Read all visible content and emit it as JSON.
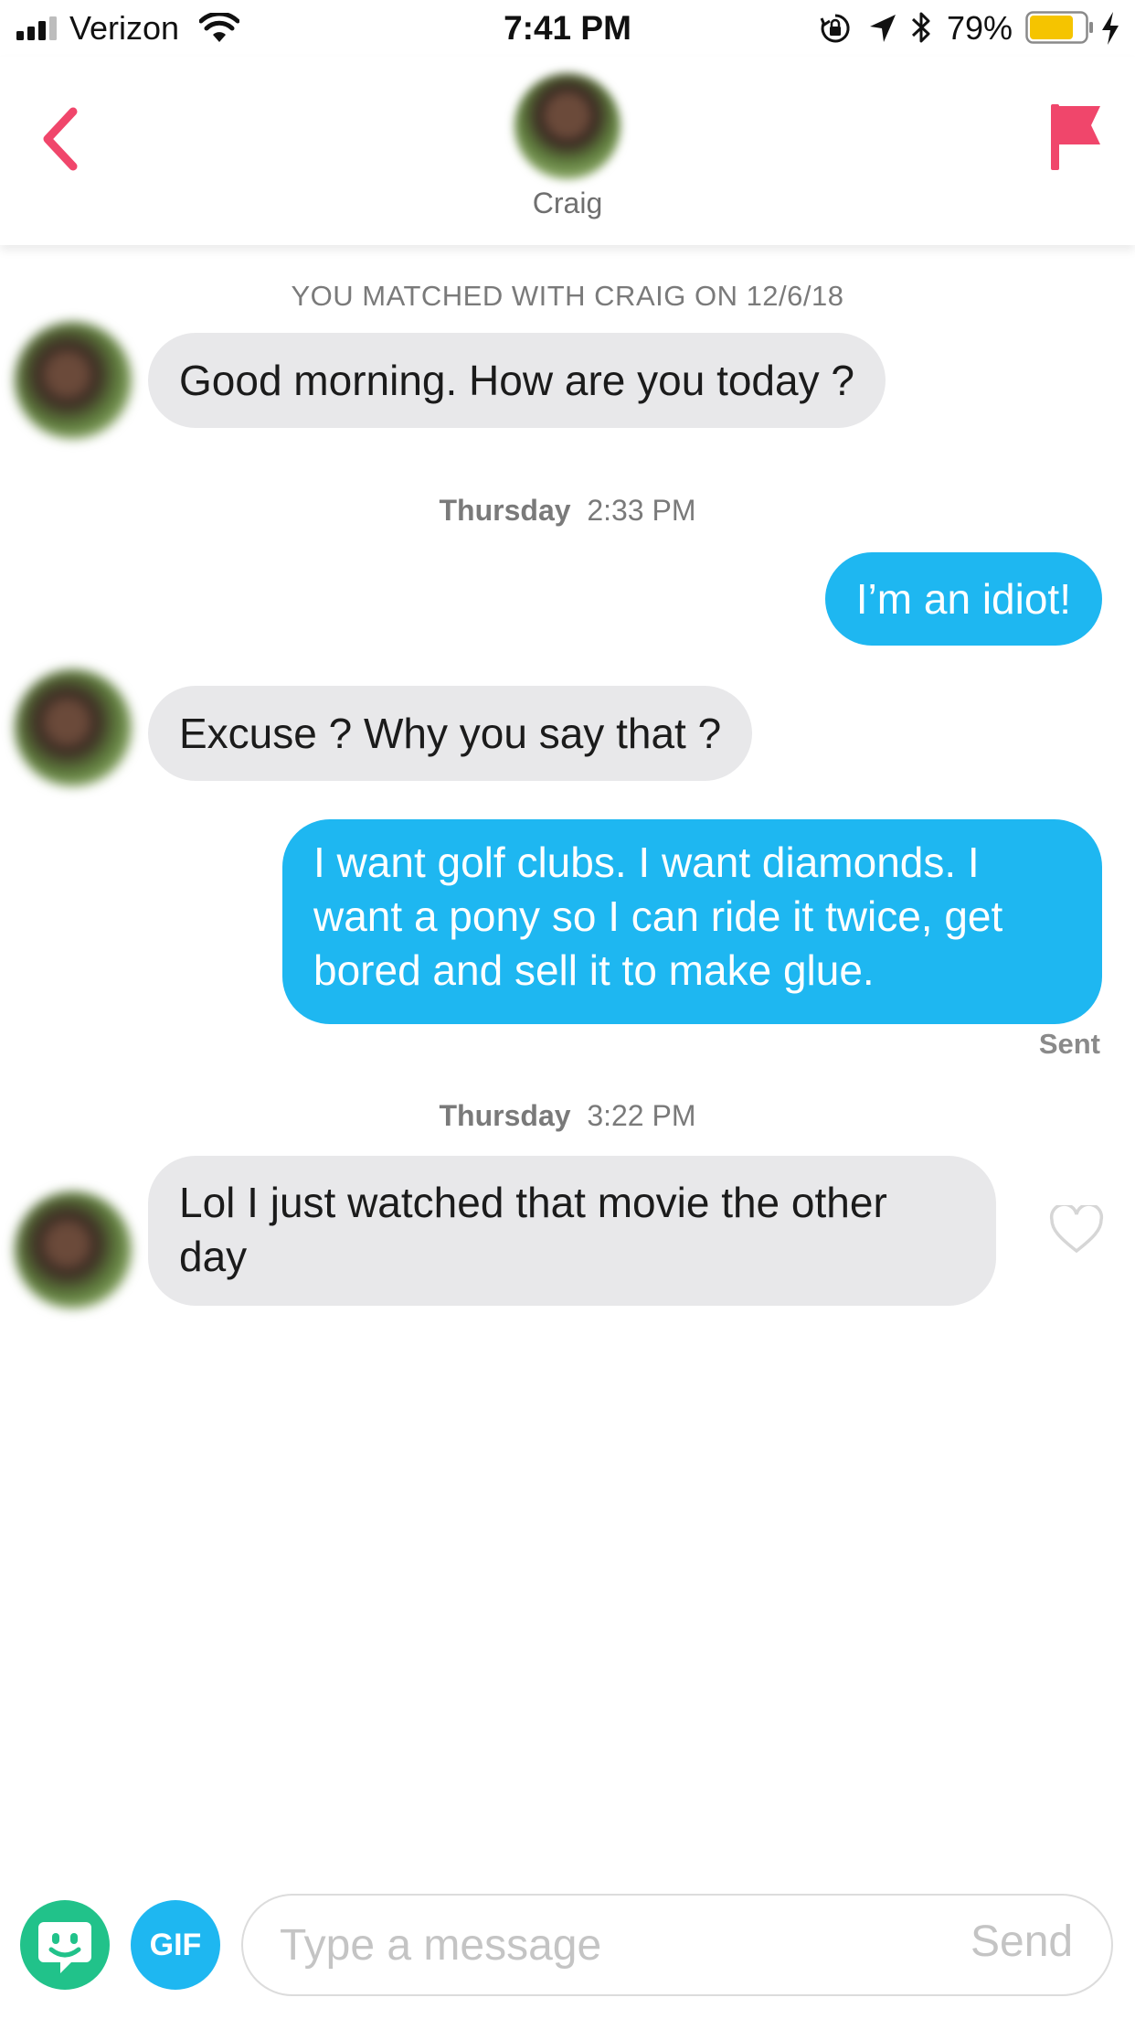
{
  "status_bar": {
    "carrier": "Verizon",
    "time": "7:41 PM",
    "battery_percent": "79%",
    "battery_level": 0.79,
    "battery_color": "#f5c400",
    "icons": [
      "signal-icon",
      "wifi-icon",
      "rotation-lock-icon",
      "location-arrow-icon",
      "bluetooth-icon",
      "battery-icon",
      "charging-bolt-icon"
    ]
  },
  "header": {
    "name": "Craig",
    "accent_color": "#f0466b",
    "icons": [
      "back-chevron-icon",
      "flag-icon"
    ]
  },
  "chat": {
    "match_notice": "YOU MATCHED WITH CRAIG ON 12/6/18",
    "messages": [
      {
        "from": "Craig",
        "direction": "incoming",
        "text": "Good morning. How are you today ?"
      },
      {
        "separator_day": "Thursday",
        "separator_time": "2:33 PM"
      },
      {
        "from": "me",
        "direction": "outgoing",
        "text": "I’m an idiot!"
      },
      {
        "from": "Craig",
        "direction": "incoming",
        "text": "Excuse ? Why you say that ?"
      },
      {
        "from": "me",
        "direction": "outgoing",
        "text": "I want golf clubs. I want diamonds. I want a pony so I can ride it twice, get bored and sell it to make glue."
      },
      {
        "status": "Sent"
      },
      {
        "separator_day": "Thursday",
        "separator_time": "3:22 PM"
      },
      {
        "from": "Craig",
        "direction": "incoming",
        "text": "Lol I just watched that movie the other day"
      }
    ],
    "outgoing_color": "#1eb7f1",
    "incoming_color": "#e8e8ea"
  },
  "composer": {
    "gif_label": "GIF",
    "placeholder": "Type a message",
    "value": "",
    "send_label": "Send",
    "sticker_color": "#21c28a"
  }
}
